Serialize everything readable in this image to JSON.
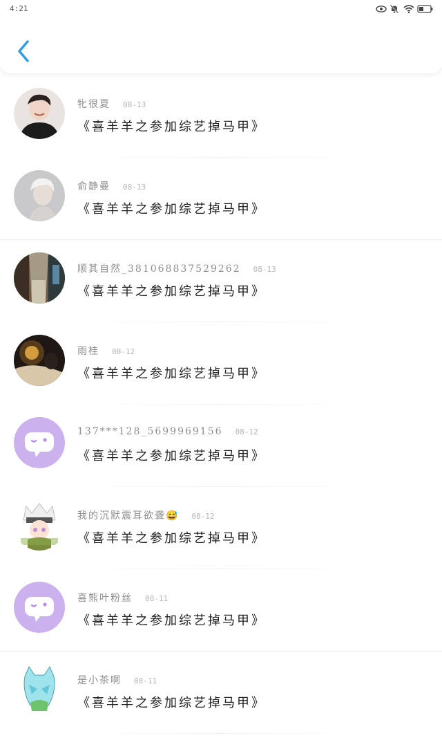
{
  "status_bar": {
    "time": "4:21"
  },
  "nav": {
    "back_icon": "chevron-left-icon",
    "accent": "#2a9de6"
  },
  "items": [
    {
      "name": "牝很夏",
      "date": "08-13",
      "title": "《喜羊羊之参加综艺掉马甲》"
    },
    {
      "name": "俞静曼",
      "date": "08-13",
      "title": "《喜羊羊之参加综艺掉马甲》"
    },
    {
      "name": "顺其自然_381068837529262",
      "date": "08-13",
      "title": "《喜羊羊之参加综艺掉马甲》"
    },
    {
      "name": "雨桂",
      "date": "08-12",
      "title": "《喜羊羊之参加综艺掉马甲》"
    },
    {
      "name": "137***128_5699969156",
      "date": "08-12",
      "title": "《喜羊羊之参加综艺掉马甲》"
    },
    {
      "name": "我的沉默震耳欲聋😅",
      "date": "08-12",
      "title": "《喜羊羊之参加综艺掉马甲》"
    },
    {
      "name": "喜熊叶粉丝",
      "date": "08-11",
      "title": "《喜羊羊之参加综艺掉马甲》"
    },
    {
      "name": "是小茶啊",
      "date": "08-11",
      "title": "《喜羊羊之参加综艺掉马甲》"
    }
  ]
}
